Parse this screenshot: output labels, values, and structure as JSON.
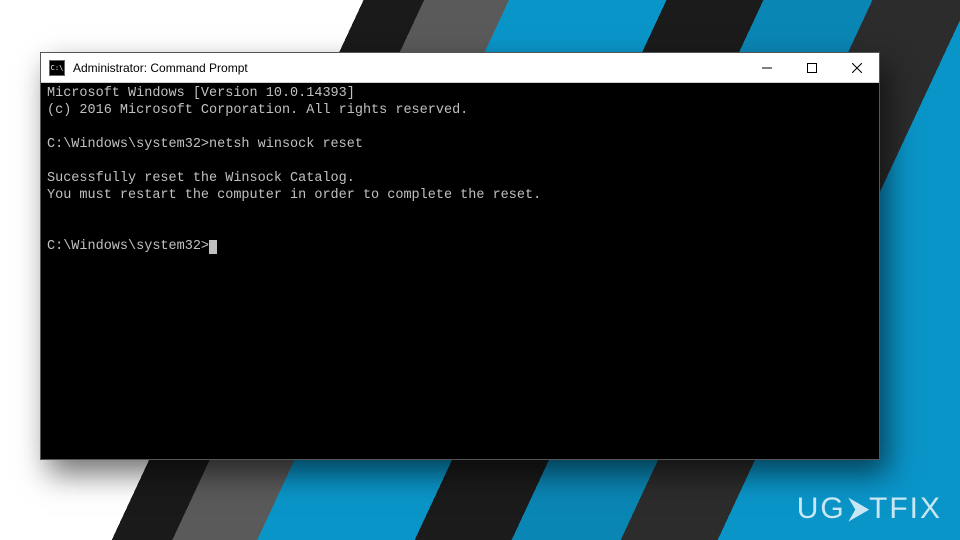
{
  "window": {
    "title": "Administrator: Command Prompt"
  },
  "terminal": {
    "line1": "Microsoft Windows [Version 10.0.14393]",
    "line2": "(c) 2016 Microsoft Corporation. All rights reserved.",
    "blank1": "",
    "prompt1_path": "C:\\Windows\\system32>",
    "prompt1_cmd": "netsh winsock reset",
    "blank2": "",
    "result1": "Sucessfully reset the Winsock Catalog.",
    "result2": "You must restart the computer in order to complete the reset.",
    "blank3": "",
    "blank4": "",
    "prompt2_path": "C:\\Windows\\system32>"
  },
  "watermark": {
    "text_pre": "UG",
    "text_mid": "⮜",
    "text_post": "TFIX"
  }
}
